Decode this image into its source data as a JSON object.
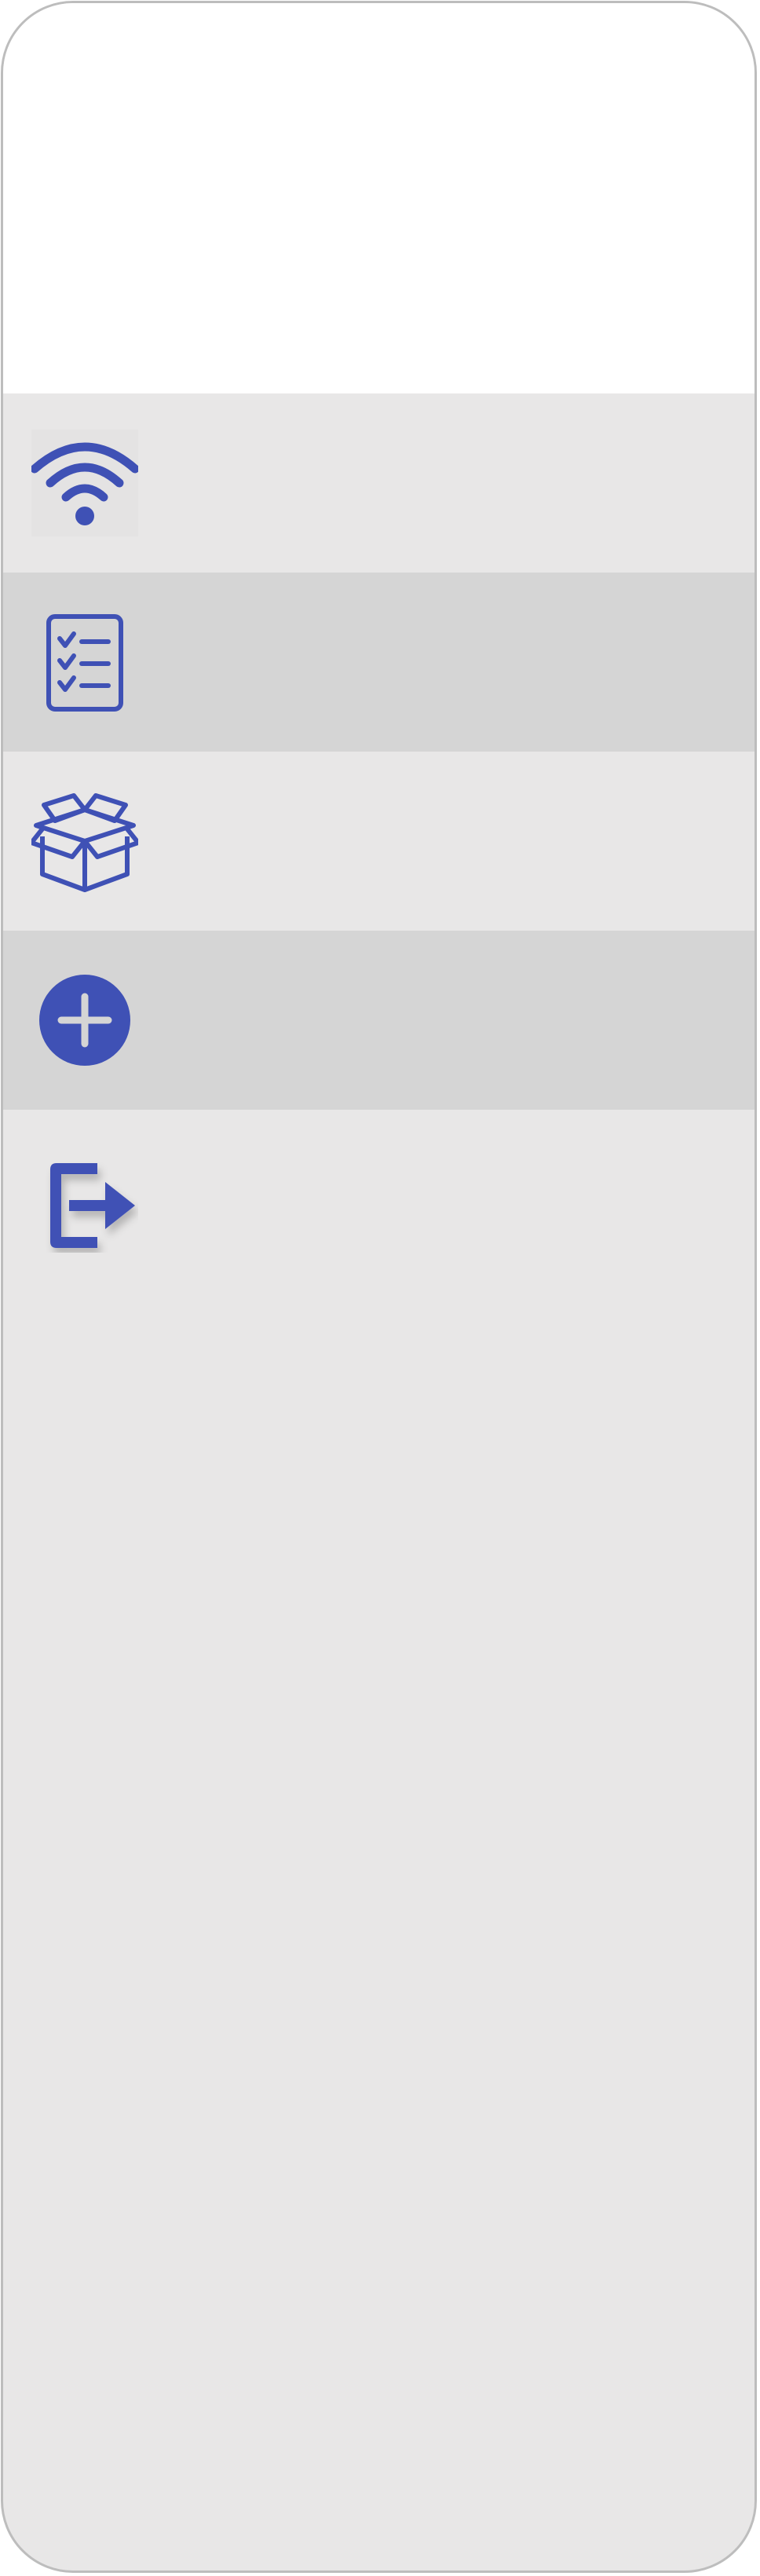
{
  "sidebar": {
    "items": [
      {
        "icon": "wifi-icon",
        "label": ""
      },
      {
        "icon": "checklist-icon",
        "label": ""
      },
      {
        "icon": "open-box-icon",
        "label": ""
      },
      {
        "icon": "add-circle-icon",
        "label": ""
      },
      {
        "icon": "logout-icon",
        "label": ""
      }
    ]
  },
  "colors": {
    "accent": "#3f51b5",
    "row_light": "#e8e7e7",
    "row_dark": "#d5d5d5",
    "frame_border": "#bdbdbd"
  }
}
